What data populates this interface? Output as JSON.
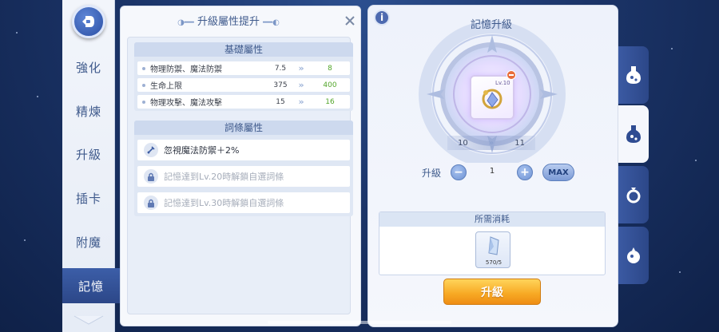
{
  "nav": {
    "items": [
      "強化",
      "精煉",
      "升級",
      "插卡",
      "附魔",
      "記憶"
    ],
    "active_index": 5
  },
  "upgrade_panel": {
    "title": "升級屬性提升",
    "base_section": {
      "header": "基礎屬性",
      "rows": [
        {
          "name": "物理防禦、魔法防禦",
          "old": "7.5",
          "new": "8"
        },
        {
          "name": "生命上限",
          "old": "375",
          "new": "400"
        },
        {
          "name": "物理攻擊、魔法攻擊",
          "old": "15",
          "new": "16"
        }
      ]
    },
    "trait_section": {
      "header": "詞條屬性",
      "rows": [
        {
          "text": "忽視魔法防禦＋2%",
          "locked": false
        },
        {
          "text": "記憶達到Lv.20時解鎖自選詞條",
          "locked": true
        },
        {
          "text": "記憶達到Lv.30時解鎖自選詞條",
          "locked": true
        }
      ]
    }
  },
  "memory_panel": {
    "title": "記憶升級",
    "item_level": "Lv.10",
    "level_from": "10",
    "level_to": "11",
    "quantity_label": "升級",
    "quantity": "1",
    "minus_label": "−",
    "plus_label": "+",
    "max_label": "MAX",
    "cost_header": "所需消耗",
    "cost_count": "570/5",
    "upgrade_label": "升級"
  },
  "colors": {
    "accent": "#3f5a8c",
    "increase_green": "#52a52a",
    "upgrade_orange": "#f7a823"
  },
  "icons": {
    "back": "back-arrow-icon",
    "close": "close-icon",
    "info": "info-icon",
    "tabs": [
      "potion-icon",
      "potion-icon",
      "ring-icon",
      "orb-icon"
    ]
  }
}
